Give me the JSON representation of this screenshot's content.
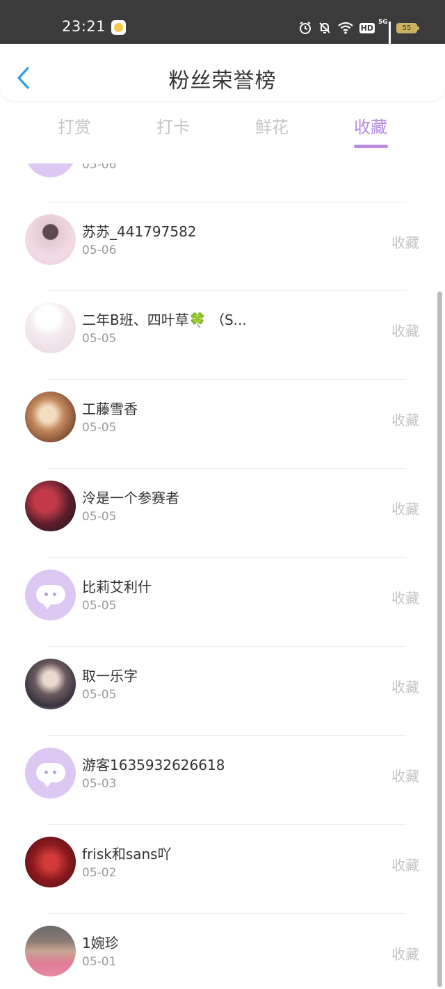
{
  "status_bar": {
    "time": "23:21",
    "hd": "HD",
    "network": "5G",
    "battery": "55"
  },
  "header": {
    "title": "粉丝荣誉榜",
    "back_icon": "chevron-left-icon"
  },
  "tabs": [
    {
      "label": "打赏",
      "active": false
    },
    {
      "label": "打卡",
      "active": false
    },
    {
      "label": "鲜花",
      "active": false
    },
    {
      "label": "收藏",
      "active": true
    }
  ],
  "accent_color": "#b78be0",
  "list": {
    "partial_top_item": {
      "date": "05-06"
    },
    "items": [
      {
        "name": "苏苏_441797582",
        "date": "05-06",
        "action": "收藏",
        "avatar": "photo"
      },
      {
        "name": "二年B班、四叶草🍀 （S...",
        "date": "05-05",
        "action": "收藏",
        "avatar": "photo"
      },
      {
        "name": "工藤雪香",
        "date": "05-05",
        "action": "收藏",
        "avatar": "photo"
      },
      {
        "name": "泠是一个参赛者",
        "date": "05-05",
        "action": "收藏",
        "avatar": "photo"
      },
      {
        "name": "比莉艾利什",
        "date": "05-05",
        "action": "收藏",
        "avatar": "default"
      },
      {
        "name": "取一乐字",
        "date": "05-05",
        "action": "收藏",
        "avatar": "photo"
      },
      {
        "name": "游客1635932626618",
        "date": "05-03",
        "action": "收藏",
        "avatar": "default"
      },
      {
        "name": "frisk和sans吖",
        "date": "05-02",
        "action": "收藏",
        "avatar": "photo"
      },
      {
        "name": "1婉珍",
        "date": "05-01",
        "action": "收藏",
        "avatar": "photo"
      }
    ]
  }
}
